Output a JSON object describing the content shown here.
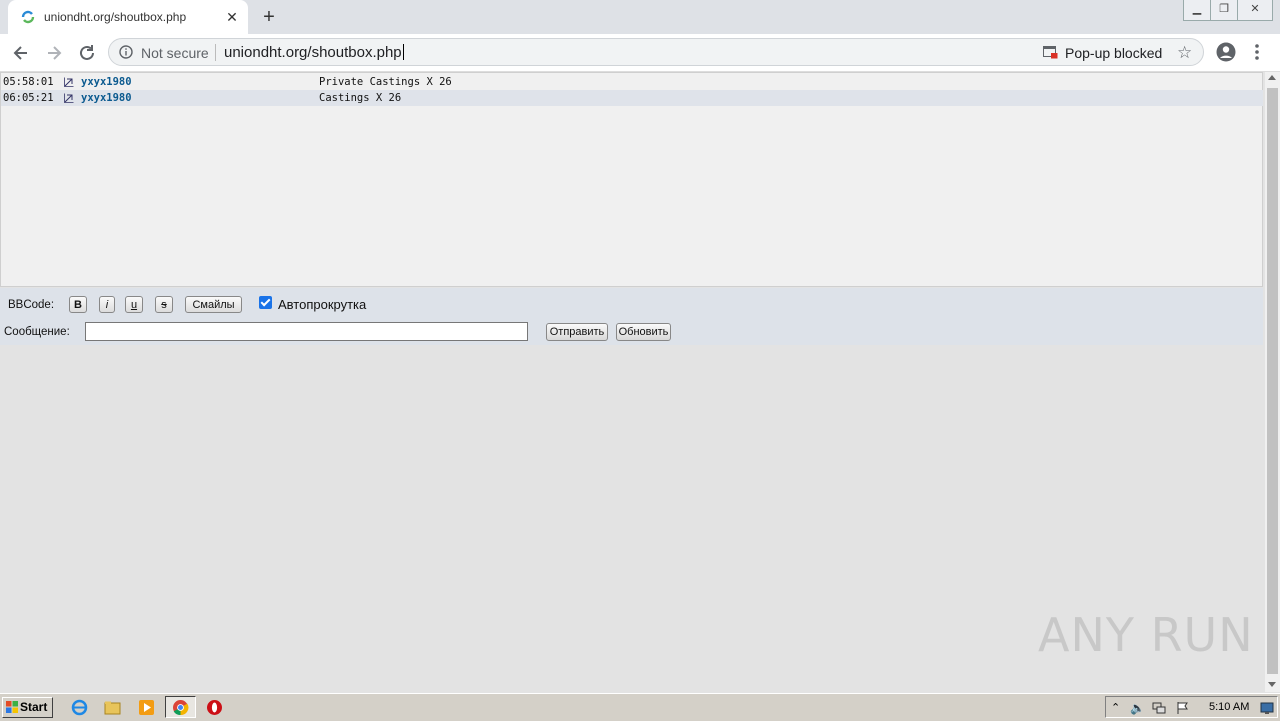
{
  "browser": {
    "tab_title": "uniondht.org/shoutbox.php",
    "tab_close": "✕",
    "new_tab": "+",
    "security": "Not secure",
    "url": "uniondht.org/shoutbox.php",
    "popup_blocked": "Pop-up blocked"
  },
  "shoutbox": {
    "messages": [
      {
        "time": "05:58:01",
        "user": "yxyx1980",
        "text": "Private Castings X 26"
      },
      {
        "time": "06:05:21",
        "user": "yxyx1980",
        "text": "Castings X 26"
      }
    ]
  },
  "form": {
    "bbcode_label": "BBCode:",
    "bold": "B",
    "italic": "i",
    "underline": "u",
    "strike": "s",
    "smileys": "Смайлы",
    "autoscroll_label": "Автопрокрутка",
    "autoscroll_checked": true,
    "message_label": "Сообщение:",
    "message_value": "",
    "send": "Отправить",
    "refresh": "Обновить"
  },
  "watermark": "ANY RUN",
  "taskbar": {
    "start": "Start",
    "clock": "5:10 AM"
  },
  "colors": {
    "accent": "#1a73e8",
    "username": "#0b5a8f",
    "form_bg": "#dde2e9"
  }
}
